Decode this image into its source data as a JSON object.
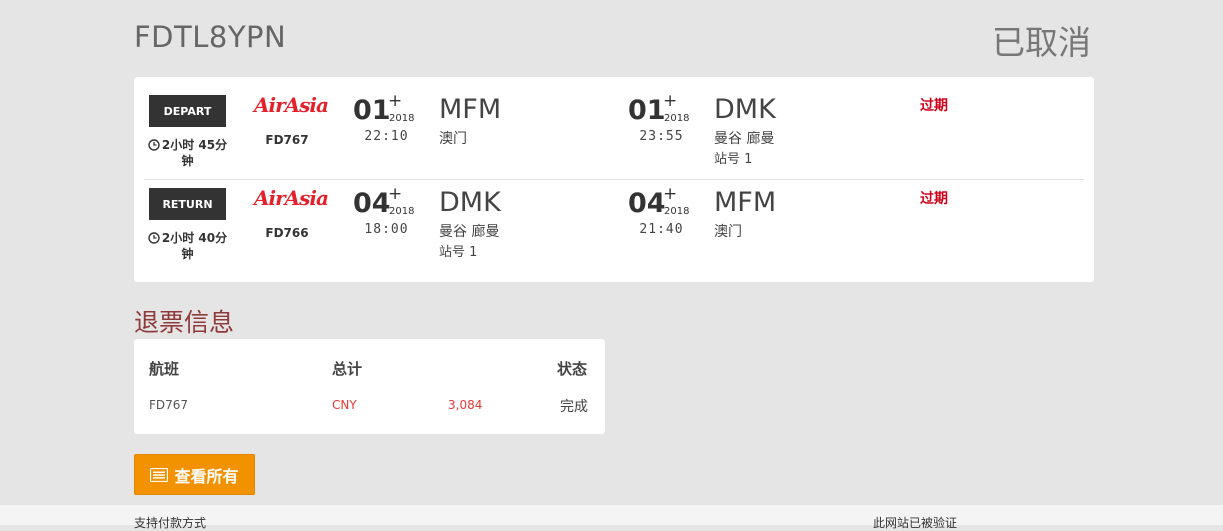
{
  "booking": {
    "reference": "FDTL8YPN",
    "status": "已取消"
  },
  "flights": [
    {
      "direction": "DEPART",
      "duration": "2小时 45分钟",
      "airline": "AirAsia",
      "flight_no": "FD767",
      "departure": {
        "day": "01",
        "plus": "+",
        "year": "2018",
        "time": "22:10",
        "code": "MFM",
        "city": "澳门",
        "terminal": ""
      },
      "arrival": {
        "day": "01",
        "plus": "+",
        "year": "2018",
        "time": "23:55",
        "code": "DMK",
        "city": "曼谷 廊曼",
        "terminal": "站号 1"
      },
      "status": "过期"
    },
    {
      "direction": "RETURN",
      "duration": "2小时 40分钟",
      "airline": "AirAsia",
      "flight_no": "FD766",
      "departure": {
        "day": "04",
        "plus": "+",
        "year": "2018",
        "time": "18:00",
        "code": "DMK",
        "city": "曼谷 廊曼",
        "terminal": "站号 1"
      },
      "arrival": {
        "day": "04",
        "plus": "+",
        "year": "2018",
        "time": "21:40",
        "code": "MFM",
        "city": "澳门",
        "terminal": ""
      },
      "status": "过期"
    }
  ],
  "refund": {
    "title": "退票信息",
    "headers": {
      "flight": "航班",
      "total": "总计",
      "status": "状态"
    },
    "rows": [
      {
        "flight": "FD767",
        "currency": "CNY",
        "amount": "3,084",
        "status": "完成"
      }
    ]
  },
  "view_all_label": "查看所有",
  "footer": {
    "left": "支持付款方式",
    "right": "此网站已被验证"
  },
  "colors": {
    "expired": "#d0021b",
    "accent_button": "#f39200",
    "airline_logo": "#e4202a",
    "refund_amount": "#e53935"
  }
}
